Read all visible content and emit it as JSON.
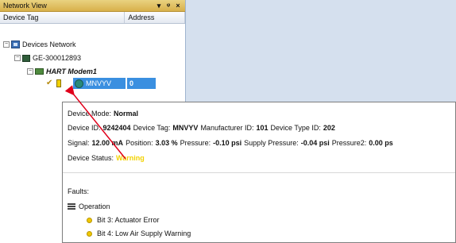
{
  "panel": {
    "title": "Network View",
    "pin_glyph": "▾ ⊕",
    "close_glyph": "×",
    "columns": [
      "Device Tag",
      "Address"
    ]
  },
  "tree": {
    "network": "Devices Network",
    "controller": "GE-300012893",
    "modem": "HART Modem1",
    "device": "MNVYV",
    "device_address": "0"
  },
  "tooltip": {
    "mode_label": "Device Mode:",
    "mode_value": "Normal",
    "id_label": "Device ID:",
    "id_value": "9242404",
    "tag_label": "Device Tag:",
    "tag_value": "MNVYV",
    "mfr_label": "Manufacturer ID:",
    "mfr_value": "101",
    "type_label": "Device Type ID:",
    "type_value": "202",
    "signal_label": "Signal:",
    "signal_value": "12.00 mA",
    "position_label": "Position:",
    "position_value": "3.03 %",
    "pressure_label": "Pressure:",
    "pressure_value": "-0.10 psi",
    "supply_label": "Supply Pressure:",
    "supply_value": "-0.04 psi",
    "pressure2_label": "Pressure2:",
    "pressure2_value": "0.00 ps",
    "status_label": "Device Status:",
    "status_value": "Warning",
    "faults_label": "Faults:",
    "group_label": "Operation",
    "faults": [
      "Bit 3: Actuator Error",
      "Bit 4: Low Air Supply Warning"
    ]
  },
  "colors": {
    "selection": "#3a8fe0",
    "warning": "#f2d200",
    "annotation_arrow": "#e0001a",
    "panel_title": "#d8b04a"
  }
}
